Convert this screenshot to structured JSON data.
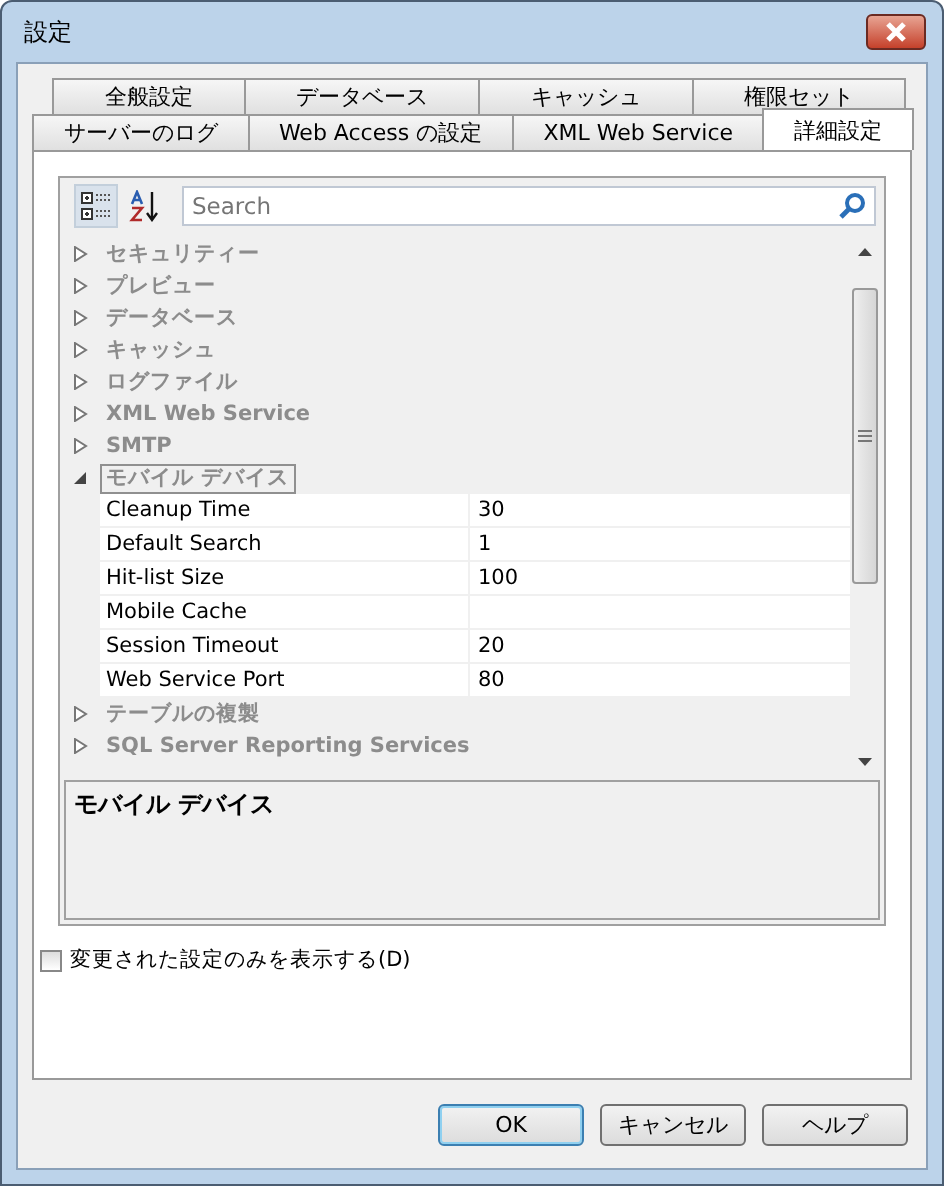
{
  "window": {
    "title": "設定"
  },
  "tab_rows": [
    [
      {
        "label": "全般設定",
        "selected": false
      },
      {
        "label": "データベース",
        "selected": false
      },
      {
        "label": "キャッシュ",
        "selected": false
      },
      {
        "label": "権限セット",
        "selected": false
      }
    ],
    [
      {
        "label": "サーバーのログ",
        "selected": false
      },
      {
        "label": "Web Access の設定",
        "selected": false
      },
      {
        "label": "XML Web Service",
        "selected": false
      },
      {
        "label": "詳細設定",
        "selected": true
      }
    ]
  ],
  "toolbar": [
    {
      "kind": "categorized",
      "selected": true
    },
    {
      "kind": "alphabetical",
      "selected": false
    }
  ],
  "search": {
    "placeholder": "Search"
  },
  "categories": [
    {
      "label": "セキュリティー",
      "expanded": false,
      "selected": false
    },
    {
      "label": "プレビュー",
      "expanded": false,
      "selected": false
    },
    {
      "label": "データベース",
      "expanded": false,
      "selected": false
    },
    {
      "label": "キャッシュ",
      "expanded": false,
      "selected": false
    },
    {
      "label": "ログファイル",
      "expanded": false,
      "selected": false
    },
    {
      "label": "XML Web Service",
      "expanded": false,
      "selected": false
    },
    {
      "label": "SMTP",
      "expanded": false,
      "selected": false
    },
    {
      "label": "モバイル デバイス",
      "expanded": true,
      "selected": true,
      "children": [
        {
          "name": "Cleanup Time",
          "value": "30"
        },
        {
          "name": "Default Search",
          "value": "1"
        },
        {
          "name": "Hit-list Size",
          "value": "100"
        },
        {
          "name": "Mobile Cache"
        },
        {
          "name": "Session Timeout",
          "value": "20"
        },
        {
          "name": "Web Service Port",
          "value": "80"
        }
      ]
    },
    {
      "label": "テーブルの複製",
      "expanded": false,
      "selected": false
    },
    {
      "label": "SQL Server Reporting Services",
      "expanded": false,
      "selected": false
    }
  ],
  "description": {
    "title": "モバイル デバイス"
  },
  "filter_checkbox": {
    "label": "変更された設定のみを表示する(D)",
    "checked": false
  },
  "buttons": [
    {
      "label": "OK",
      "default": true
    },
    {
      "label": "キャンセル",
      "default": false
    },
    {
      "label": "ヘルプ",
      "default": false
    }
  ]
}
